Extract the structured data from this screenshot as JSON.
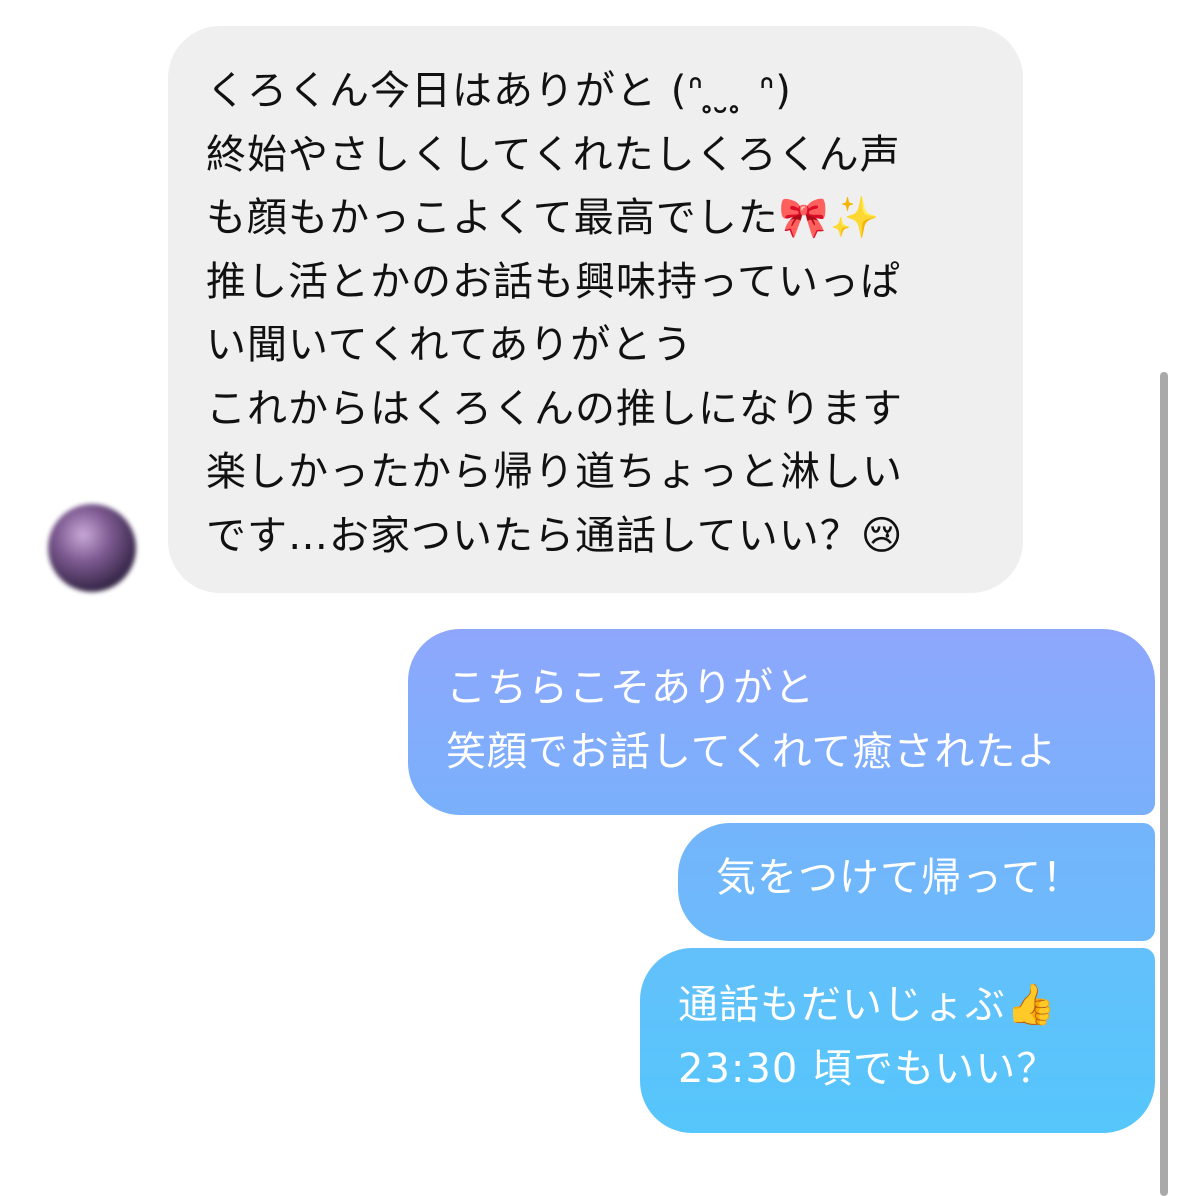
{
  "incoming": {
    "lines": [
      "くろくん今日はありがと (ᐢ ̥ ̮ ̥ ᐢ)",
      "終始やさしくしてくれたしくろくん声",
      "も顔もかっこよくて最高でした🎀✨",
      "推し活とかのお話も興味持っていっぱ",
      "い聞いてくれてありがとう",
      "これからはくろくんの推しになります",
      "楽しかったから帰り道ちょっと淋しい",
      "です…お家ついたら通話していい？😢"
    ]
  },
  "outgoing": [
    {
      "lines": [
        "こちらこそありがと",
        "笑顔でお話してくれて癒されたよ"
      ]
    },
    {
      "lines": [
        "気をつけて帰って！"
      ]
    },
    {
      "lines": [
        "通話もだいじょぶ👍",
        "23:30 頃でもいい？"
      ]
    }
  ],
  "colors": {
    "incoming_bubble": "#efefef",
    "outgoing_top": "#8ea7fd",
    "outgoing_bottom": "#55c6fb"
  }
}
